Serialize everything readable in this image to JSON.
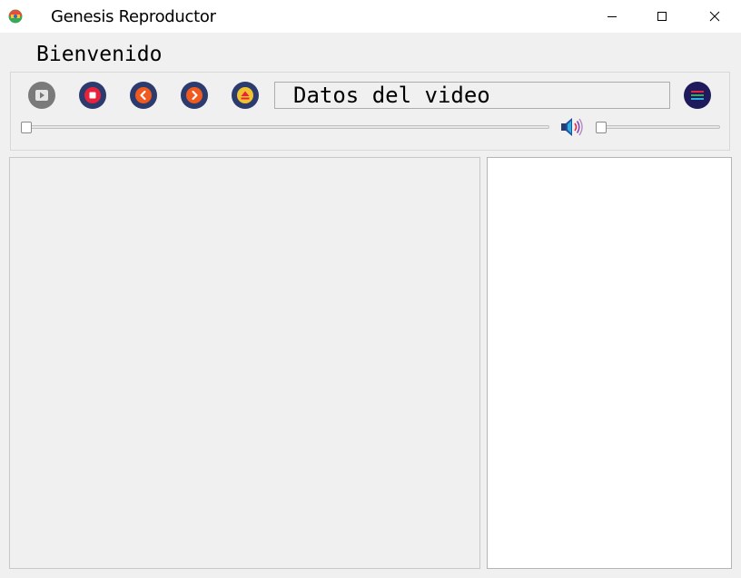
{
  "window": {
    "title": "Genesis Reproductor"
  },
  "header": {
    "welcome": "Bienvenido"
  },
  "controls": {
    "icons": [
      "play-icon",
      "stop-icon",
      "previous-icon",
      "next-icon",
      "eject-icon",
      "volume-icon",
      "menu-icon"
    ],
    "video_info": "Datos del video"
  },
  "sliders": {
    "progress": 0,
    "volume": 0
  },
  "colors": {
    "play_gray": "#7a7a7a",
    "stop_red": "#e8223a",
    "prev_orange": "#f05a1e",
    "next_orange": "#f05a1e",
    "button_navy": "#2c3b6e",
    "eject_yellow": "#f2c12e",
    "menu_navy": "#1e1a5c"
  }
}
